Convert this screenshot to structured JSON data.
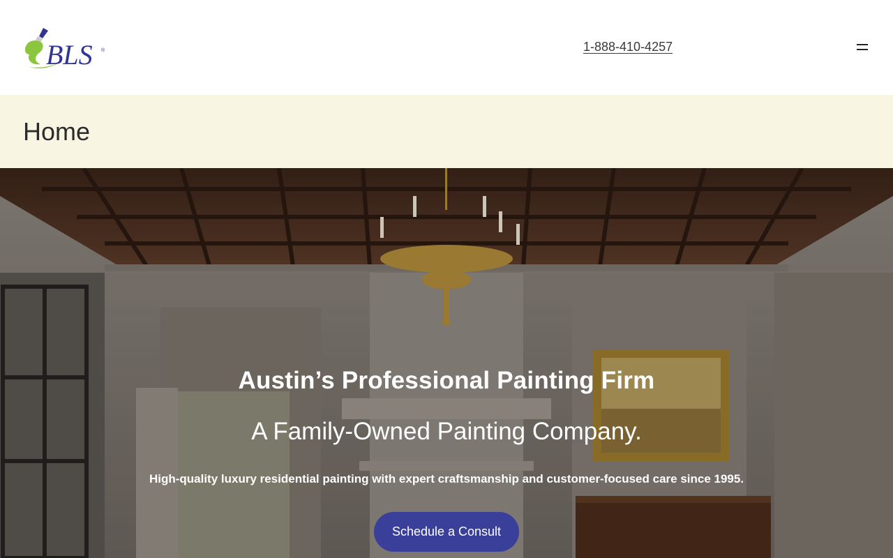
{
  "header": {
    "logo_text": "BLS",
    "phone": "1-888-410-4257",
    "menu_icon": "hamburger-icon"
  },
  "page": {
    "title": "Home"
  },
  "hero": {
    "heading": "Austin’s Professional Painting Firm",
    "subheading": "A Family-Owned Painting Company.",
    "text": "High-quality luxury residential painting with expert craftsmanship and customer-focused care since 1995.",
    "cta_label": "Schedule a Consult",
    "background": "interior-room-photo"
  },
  "colors": {
    "brand_blue": "#2f3594",
    "brand_green": "#8cc63f",
    "title_band": "#f8f5e3",
    "cta_button": "#3a3f9a"
  }
}
